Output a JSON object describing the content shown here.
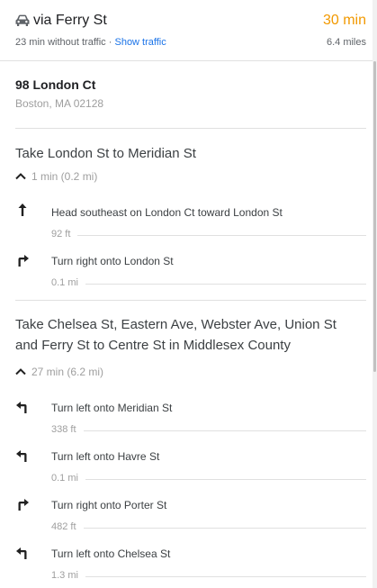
{
  "route": {
    "via": "via Ferry St",
    "duration": "30 min",
    "traffic_note": "23 min without traffic",
    "separator": "·",
    "show_traffic": "Show traffic",
    "distance": "6.4 miles"
  },
  "destination": {
    "name": "98 London Ct",
    "address": "Boston, MA 02128"
  },
  "sections": [
    {
      "title": "Take London St to Meridian St",
      "meta": "1 min (0.2 mi)",
      "steps": [
        {
          "icon": "arrow-straight-icon",
          "text": "Head southeast on London Ct toward London St",
          "dist": "92 ft"
        },
        {
          "icon": "turn-right-icon",
          "text": "Turn right onto London St",
          "dist": "0.1 mi"
        }
      ]
    },
    {
      "title": "Take Chelsea St, Eastern Ave, Webster Ave, Union St and Ferry St to Centre St in Middlesex County",
      "meta": "27 min (6.2 mi)",
      "steps": [
        {
          "icon": "turn-left-icon",
          "text": "Turn left onto Meridian St",
          "dist": "338 ft"
        },
        {
          "icon": "turn-left-icon",
          "text": "Turn left onto Havre St",
          "dist": "0.1 mi"
        },
        {
          "icon": "turn-right-icon",
          "text": "Turn right onto Porter St",
          "dist": "482 ft"
        },
        {
          "icon": "turn-left-icon",
          "text": "Turn left onto Chelsea St",
          "dist": "1.3 mi"
        }
      ]
    }
  ],
  "colors": {
    "duration": "#f29900",
    "link": "#1a73e8",
    "muted": "#9e9e9e"
  }
}
